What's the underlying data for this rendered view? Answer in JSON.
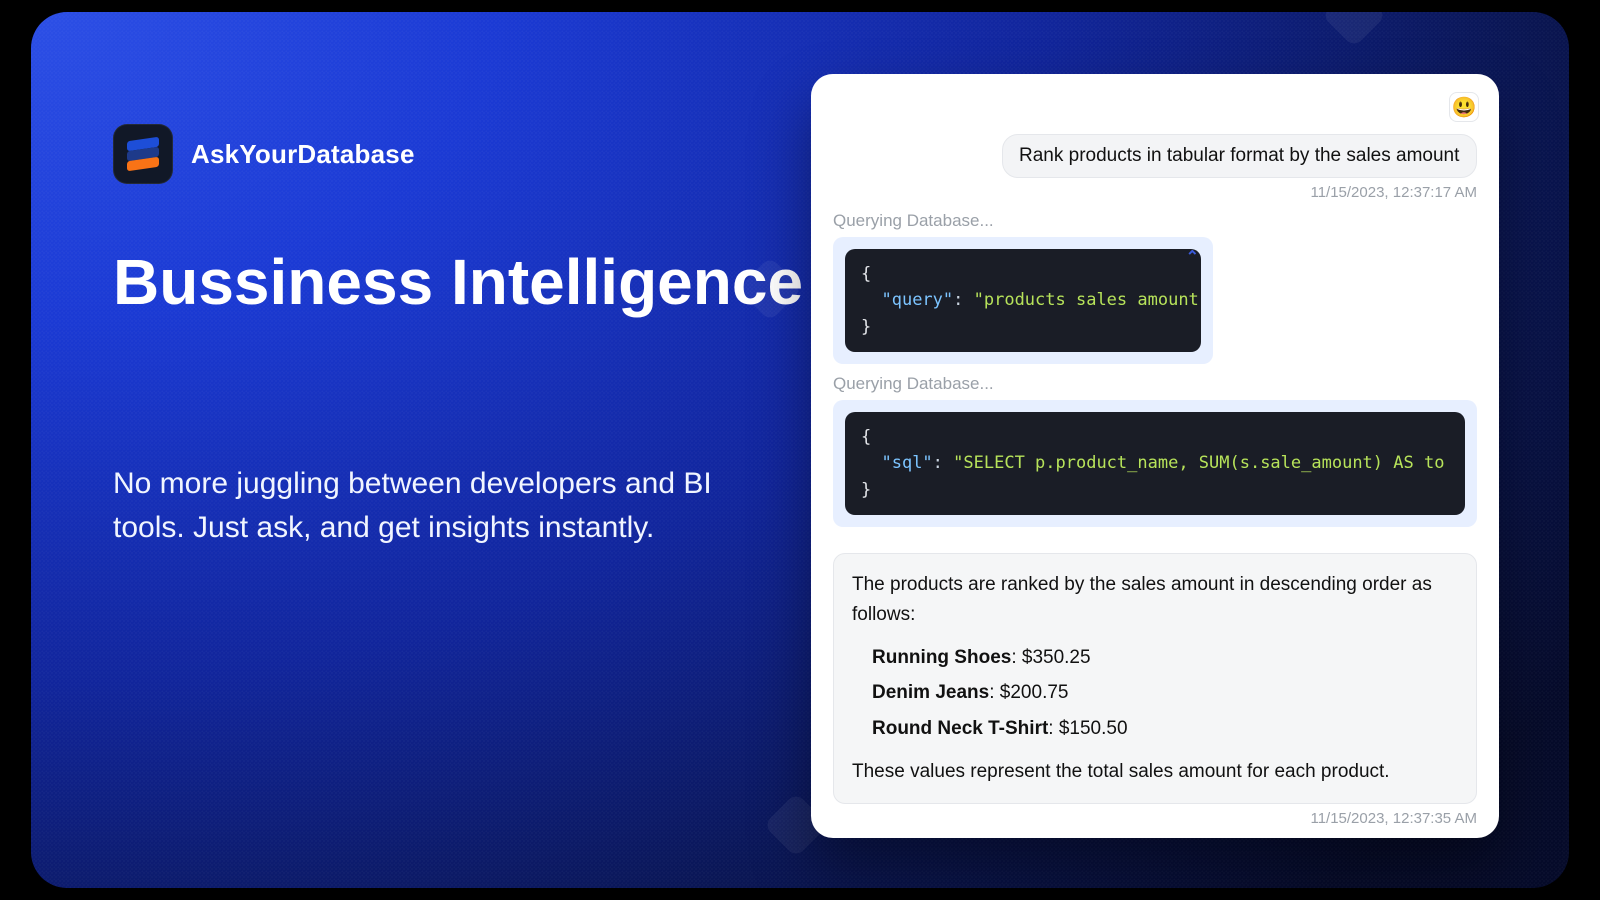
{
  "brand": {
    "name": "AskYourDatabase"
  },
  "headline": "Bussiness Intelligence",
  "subhead": "No more juggling between developers and BI tools. Just ask, and get insights instantly.",
  "chat": {
    "emoji": "😃",
    "user_message": "Rank products in tabular format by the sales amount",
    "user_timestamp": "11/15/2023, 12:37:17 AM",
    "status_label": "Querying Database...",
    "code1": {
      "open": "{",
      "key": "\"query\"",
      "colon": ": ",
      "value": "\"products sales amount\"",
      "close": "}"
    },
    "code2": {
      "open": "{",
      "key": "\"sql\"",
      "colon": ": ",
      "value": "\"SELECT p.product_name, SUM(s.sale_amount) AS to",
      "close": "}"
    },
    "answer_intro": "The products are ranked by the sales amount in descending order as follows:",
    "products": [
      {
        "name": "Running Shoes",
        "amount": "$350.25"
      },
      {
        "name": "Denim Jeans",
        "amount": "$200.75"
      },
      {
        "name": "Round Neck T-Shirt",
        "amount": "$150.50"
      }
    ],
    "answer_outro": "These values represent the total sales amount for each product.",
    "answer_timestamp": "11/15/2023, 12:37:35 AM"
  }
}
